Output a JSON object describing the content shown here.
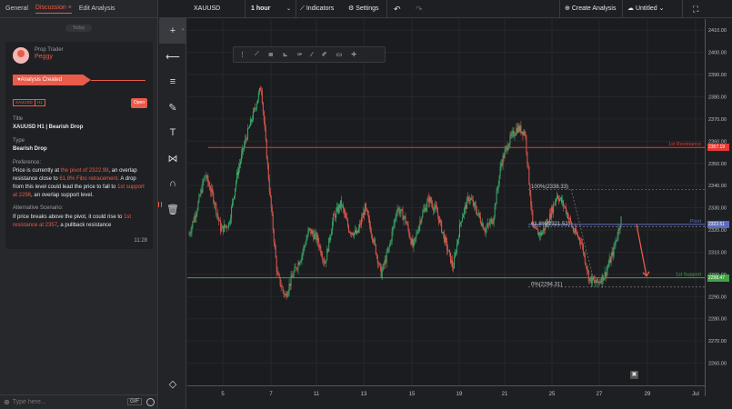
{
  "left_panel": {
    "tabs": [
      "General",
      "Discussion",
      "Edit Analysis"
    ],
    "tab_close": "×",
    "today_label": "Today",
    "author_role": "Prop Trader",
    "author_name": "Peggy",
    "ribbon": "Analysis Created",
    "chips": [
      "XAUUSD",
      "H1"
    ],
    "open_label": "Open",
    "title_label": "Title",
    "title_value": "XAUUSD H1 | Bearish Drop",
    "type_label": "Type",
    "type_value": "Bearish Drop",
    "preference_label": "Preference:",
    "preference_parts": [
      "Price is currently at ",
      "the pivot of 2322.99",
      ", an overlap resistance close to ",
      "61.8% Fibo retracement.",
      "  A drop from this level could lead the price to fall to ",
      "1st support at 2298",
      ", an overlap support level."
    ],
    "alternative_label": "Alternative Scenario:",
    "alternative_parts": [
      "If price breaks above the pivot, it could rise to ",
      "1st resistance at 2357",
      ", a pullback resistance"
    ],
    "time": "11:28",
    "input_placeholder": "Type here...",
    "gif_label": "GIF"
  },
  "top_bar": {
    "symbol": "XAUUSD",
    "interval": "1 hour",
    "indicators": "Indicators",
    "settings": "Settings",
    "create_analysis": "Create Analysis",
    "layout_name": "Untitled"
  },
  "chart_data": {
    "type": "candlestick",
    "symbol": "XAUUSD",
    "timeframe": "1 hour",
    "ylim": [
      2250,
      2415
    ],
    "y_ticks": [
      2260,
      2270,
      2280,
      2290,
      2300,
      2310,
      2320,
      2330,
      2340,
      2350,
      2360,
      2370,
      2380,
      2390,
      2400,
      2410
    ],
    "x_ticks": [
      "5",
      "7",
      "11",
      "13",
      "15",
      "19",
      "21",
      "25",
      "27",
      "29",
      "Jul"
    ],
    "levels": [
      {
        "name": "1st Resistance",
        "value": 2357.19,
        "color": "#e53935"
      },
      {
        "name": "Pivot",
        "value": 2322.51,
        "color": "#5c6bc0"
      },
      {
        "name": "1st Support",
        "value": 2298.47,
        "color": "#43a047"
      }
    ],
    "fibonacci": [
      {
        "label": "100%(2338.33)",
        "value": 2338.33
      },
      {
        "label": "61.8%(2321.52)",
        "value": 2321.52
      },
      {
        "label": "0%(2294.31)",
        "value": 2294.31
      }
    ],
    "price_path": [
      2318,
      2330,
      2345,
      2335,
      2320,
      2323,
      2345,
      2360,
      2372,
      2385,
      2340,
      2300,
      2290,
      2300,
      2308,
      2320,
      2316,
      2305,
      2325,
      2332,
      2320,
      2318,
      2330,
      2316,
      2300,
      2312,
      2330,
      2325,
      2312,
      2326,
      2334,
      2328,
      2315,
      2303,
      2325,
      2335,
      2328,
      2320,
      2325,
      2350,
      2360,
      2366,
      2364,
      2320,
      2318,
      2325,
      2336,
      2330,
      2320,
      2315,
      2298,
      2296,
      2300,
      2310,
      2325
    ],
    "projection": [
      2322.5,
      2298
    ]
  }
}
